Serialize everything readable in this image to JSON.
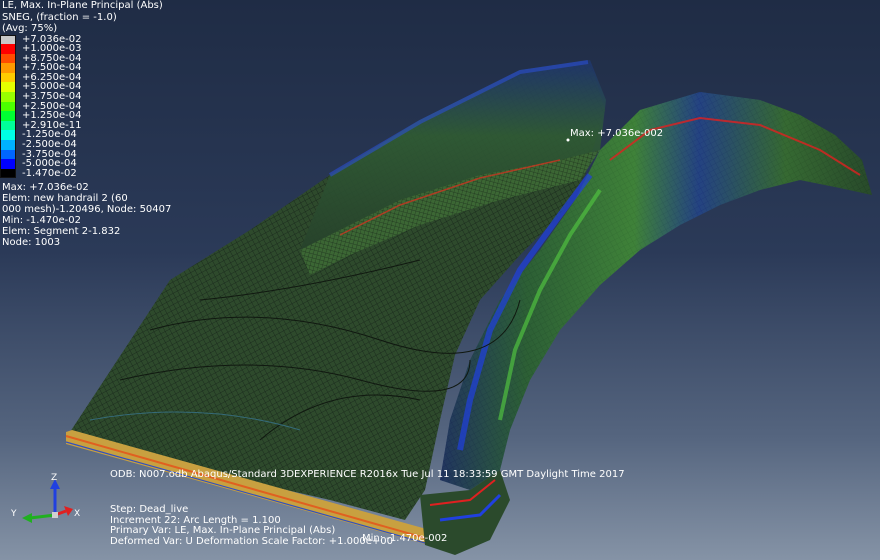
{
  "legend": {
    "title_lines": [
      "LE, Max. In-Plane Principal (Abs)",
      "SNEG, (fraction = -1.0)",
      "(Avg: 75%)"
    ],
    "entries": [
      {
        "label": "+7.036e-02",
        "color": "#c8c8c8"
      },
      {
        "label": "+1.000e-03",
        "color": "#ff0000"
      },
      {
        "label": "+8.750e-04",
        "color": "#ff4c00"
      },
      {
        "label": "+7.500e-04",
        "color": "#ff9900"
      },
      {
        "label": "+6.250e-04",
        "color": "#ffcc00"
      },
      {
        "label": "+5.000e-04",
        "color": "#e5ff00"
      },
      {
        "label": "+3.750e-04",
        "color": "#99ff00"
      },
      {
        "label": "+2.500e-04",
        "color": "#4cff00"
      },
      {
        "label": "+1.250e-04",
        "color": "#00ff33"
      },
      {
        "label": "+2.910e-11",
        "color": "#00ff99"
      },
      {
        "label": "-1.250e-04",
        "color": "#00ffe5"
      },
      {
        "label": "-2.500e-04",
        "color": "#00b2ff"
      },
      {
        "label": "-3.750e-04",
        "color": "#0066ff"
      },
      {
        "label": "-5.000e-04",
        "color": "#0000ff"
      },
      {
        "label": "-1.470e-02",
        "color": "#000000"
      }
    ],
    "info_lines": [
      "Max: +7.036e-02",
      "  Elem: new handrail 2 (60",
      "000 mesh)-1.20496,  Node: 50407",
      "Min: -1.470e-02",
      "  Elem: Segment 2-1.832",
      "  Node: 1003"
    ]
  },
  "viewport": {
    "max_label": "Max: +7.036e-002",
    "min_label": "Min: -1.470e-002",
    "odb_line": "ODB: N007.odb    Abaqus/Standard 3DEXPERIENCE R2016x    Tue Jul 11 18:33:59 GMT Daylight Time 2017",
    "step_lines": [
      "Step: Dead_live",
      "Increment      22: Arc Length =      1.100",
      "Primary Var: LE, Max. In-Plane Principal (Abs)",
      "Deformed Var: U   Deformation Scale Factor: +1.000e+00"
    ]
  },
  "triad": {
    "x": "X",
    "y": "Y",
    "z": "Z",
    "x_color": "#e02020",
    "y_color": "#20b020",
    "z_color": "#2040e0"
  },
  "colors": {
    "mesh_green": "#2f5a2a",
    "background_top": "#1f2c45",
    "background_bottom": "#8593a6"
  }
}
